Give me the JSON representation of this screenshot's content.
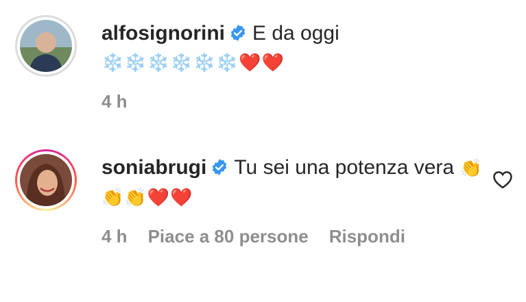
{
  "comments": [
    {
      "username": "alfosignorini",
      "text": "E da oggi",
      "emoji_line": "❄️❄️❄️❄️❄️❄️❤️❤️",
      "time": "4 h"
    },
    {
      "username": "soniabrugi",
      "text": "Tu sei una potenza vera",
      "emoji": "👏👏👏❤️❤️",
      "time": "4 h",
      "likes": "Piace a 80 persone",
      "reply": "Rispondi"
    }
  ],
  "colors": {
    "verified": "#3897f0",
    "meta_text": "#8e8e8e",
    "text": "#262626"
  },
  "icons": {
    "verified": "verified-badge-icon",
    "like": "heart-outline-icon"
  }
}
